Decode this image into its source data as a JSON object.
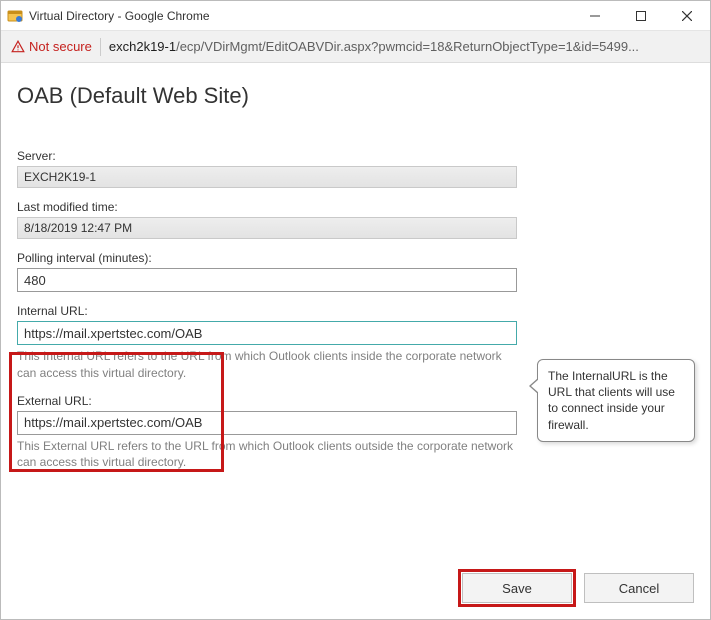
{
  "window": {
    "title": "Virtual Directory - Google Chrome"
  },
  "addressbar": {
    "not_secure": "Not secure",
    "host": "exch2k19-1",
    "path": "/ecp/VDirMgmt/EditOABVDir.aspx?pwmcid=18&ReturnObjectType=1&id=5499..."
  },
  "page": {
    "title": "OAB (Default Web Site)"
  },
  "fields": {
    "server_label": "Server:",
    "server_value": "EXCH2K19-1",
    "modified_label": "Last modified time:",
    "modified_value": "8/18/2019 12:47 PM",
    "polling_label": "Polling interval (minutes):",
    "polling_value": "480",
    "internal_label": "Internal URL:",
    "internal_value": "https://mail.xpertstec.com/OAB",
    "internal_helper": "This Internal URL refers to the URL from which Outlook clients inside the corporate network can access this virtual directory.",
    "external_label": "External URL:",
    "external_value": "https://mail.xpertstec.com/OAB",
    "external_helper": "This External URL refers to the URL from which Outlook clients outside the corporate network can access this virtual directory."
  },
  "callout": {
    "text": "The InternalURL is the URL that clients will use to connect inside your firewall."
  },
  "buttons": {
    "save": "Save",
    "cancel": "Cancel"
  }
}
